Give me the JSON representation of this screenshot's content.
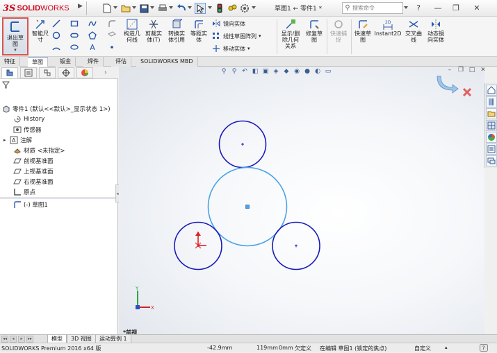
{
  "app": {
    "logo_ds": "3S",
    "logo_solid": "SOLID",
    "logo_works": "WORKS",
    "title": "草图1 ← 零件1 *",
    "search_placeholder": "搜索命令"
  },
  "titlebar_icons": [
    "new-file-icon",
    "open-folder-icon",
    "save-icon",
    "print-icon",
    "undo-icon",
    "select-arrow-icon",
    "traffic-light-icon",
    "rebuild-icon",
    "options-gear-icon"
  ],
  "ribbon": {
    "exit_sketch": "退出草\n图",
    "smart_dimension": "智能尺\n寸",
    "construction_geometry": "构造几\n何线",
    "trim_entities": "剪裁实\n体(T)",
    "convert_entities": "转换实\n体引用",
    "offset_entities": "等距实\n体",
    "mirror_entities": "镜向实体",
    "linear_pattern": "线性草图阵列",
    "move_entities": "移动实体",
    "display_relations": "显示/删\n除几何\n关系",
    "repair_sketch": "修复草\n图",
    "quick_snaps": "快速捕\n捉",
    "rapid_sketch": "快速草\n图",
    "instant2d": "Instant2D",
    "intersection_curve": "交叉曲\n线",
    "dynamic_mirror": "动态镜\n向实体"
  },
  "tabs": [
    "特征",
    "草图",
    "钣金",
    "焊件",
    "评估",
    "SOLIDWORKS MBD"
  ],
  "active_tab": "草图",
  "feature_tree": {
    "root": "零件1  (默认<<默认>_显示状态 1>)",
    "items": [
      {
        "icon": "history-icon",
        "label": "History"
      },
      {
        "icon": "sensor-icon",
        "label": "传感器"
      },
      {
        "icon": "annotations-icon",
        "label": "注解",
        "expandable": true
      },
      {
        "icon": "material-icon",
        "label": "材质 <未指定>"
      },
      {
        "icon": "plane-icon",
        "label": "前视基准面"
      },
      {
        "icon": "plane-icon",
        "label": "上视基准面"
      },
      {
        "icon": "plane-icon",
        "label": "右视基准面"
      },
      {
        "icon": "origin-icon",
        "label": "原点"
      },
      {
        "icon": "sketch-icon",
        "label": "(-) 草图1"
      }
    ]
  },
  "graphics": {
    "view_label": "*前视",
    "circles": [
      {
        "role": "top-small",
        "color": "#1a1ab8"
      },
      {
        "role": "center-large",
        "color": "#4aa3e8"
      },
      {
        "role": "left-small",
        "color": "#1a1ab8"
      },
      {
        "role": "right-small",
        "color": "#1a1ab8"
      }
    ],
    "triad": {
      "x": "X",
      "y": "Y"
    }
  },
  "bottom_tabs": [
    "模型",
    "3D 视图",
    "运动算例 1"
  ],
  "active_bottom_tab": "模型",
  "status": {
    "product": "SOLIDWORKS Premium 2016 x64 版",
    "x": "-42.9mm",
    "y": "119mm",
    "z": "0mm",
    "definition": "欠定义",
    "editing": "在编辑 草图1 (锁定的焦点)",
    "units": "自定义"
  }
}
